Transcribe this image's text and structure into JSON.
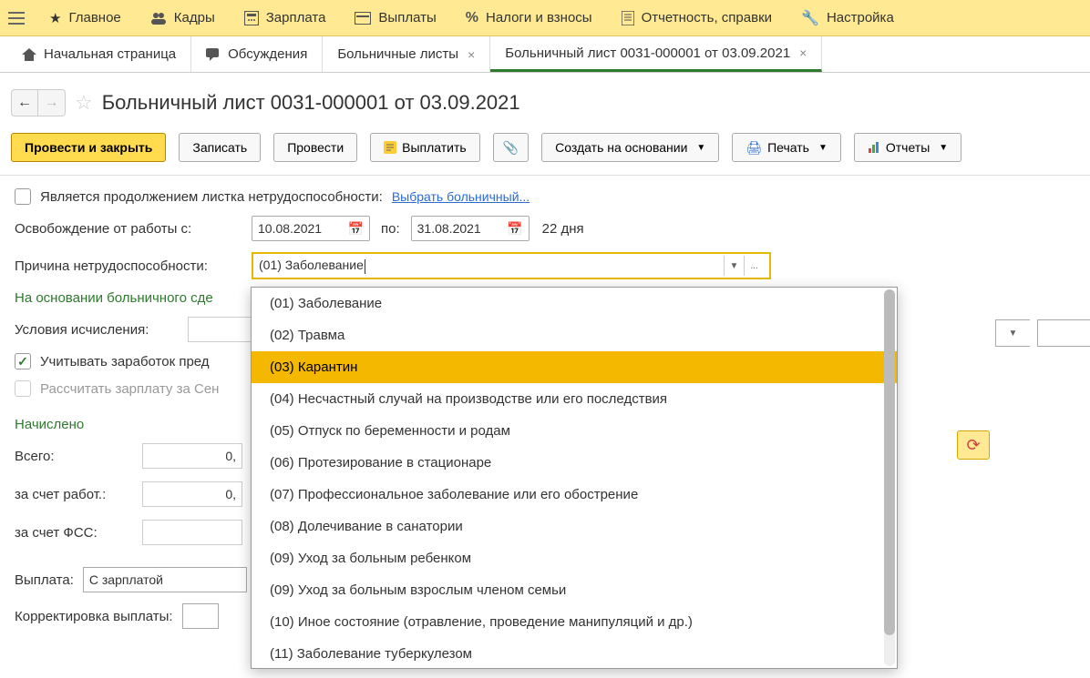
{
  "topMenu": [
    {
      "label": "Главное",
      "icon": "star"
    },
    {
      "label": "Кадры",
      "icon": "people"
    },
    {
      "label": "Зарплата",
      "icon": "calc"
    },
    {
      "label": "Выплаты",
      "icon": "wallet"
    },
    {
      "label": "Налоги и взносы",
      "icon": "percent"
    },
    {
      "label": "Отчетность, справки",
      "icon": "doc"
    },
    {
      "label": "Настройка",
      "icon": "wrench"
    }
  ],
  "tabs": [
    {
      "label": "Начальная страница",
      "icon": "home",
      "closable": false
    },
    {
      "label": "Обсуждения",
      "icon": "chat",
      "closable": false
    },
    {
      "label": "Больничные листы",
      "icon": "",
      "closable": true
    },
    {
      "label": "Больничный лист 0031-000001 от 03.09.2021",
      "icon": "",
      "closable": true,
      "active": true
    }
  ],
  "pageTitle": "Больничный лист 0031-000001 от 03.09.2021",
  "toolbar": {
    "postClose": "Провести и закрыть",
    "save": "Записать",
    "post": "Провести",
    "pay": "Выплатить",
    "createBased": "Создать на основании",
    "print": "Печать",
    "reports": "Отчеты"
  },
  "form": {
    "continuationLabel": "Является продолжением листка нетрудоспособности:",
    "selectSickLeave": "Выбрать больничный...",
    "releaseLabel": "Освобождение от работы с:",
    "dateFrom": "10.08.2021",
    "toLabel": "по:",
    "dateTo": "31.08.2021",
    "daysLabel": "22 дня",
    "reasonLabel": "Причина нетрудоспособности:",
    "reasonValue": "(01) Заболевание",
    "basisLabel": "На основании больничного сде",
    "conditionsLabel": "Условия исчисления:",
    "considerLabel": "Учитывать заработок пред",
    "recalcLabel": "Рассчитать зарплату за Сен"
  },
  "accrued": {
    "title": "Начислено",
    "totalLabel": "Всего:",
    "totalValue": "0,",
    "employerLabel": "за счет работ.:",
    "employerValue": "0,",
    "fssLabel": "за счет ФСС:",
    "fssValue": ""
  },
  "payment": {
    "label": "Выплата:",
    "value": "С зарплатой"
  },
  "correction": {
    "label": "Корректировка выплаты:"
  },
  "dropdown": [
    "(01) Заболевание",
    "(02) Травма",
    "(03) Карантин",
    "(04) Несчастный случай на производстве или его последствия",
    "(05) Отпуск по беременности и родам",
    "(06) Протезирование в стационаре",
    "(07) Профессиональное заболевание или его обострение",
    "(08) Долечивание в санатории",
    "(09) Уход за больным ребенком",
    "(09) Уход за больным взрослым членом семьи",
    "(10) Иное состояние (отравление, проведение манипуляций и др.)",
    "(11) Заболевание туберкулезом"
  ],
  "dropdownHoverIndex": 2
}
